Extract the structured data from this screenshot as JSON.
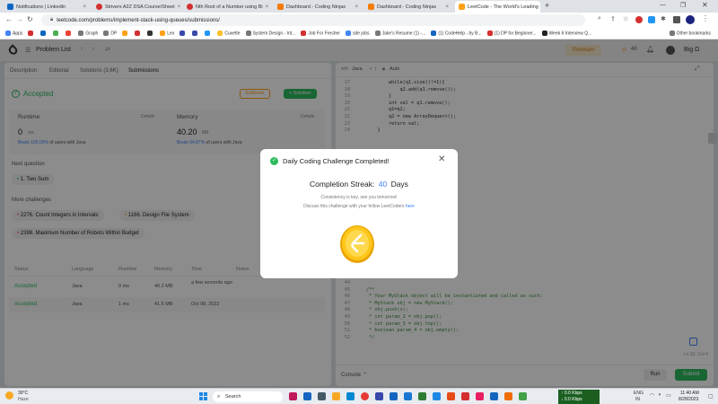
{
  "browser": {
    "tabs": [
      {
        "title": "Notifications | LinkedIn",
        "color": "#0a66c2"
      },
      {
        "title": "Strivers A2Z DSA Course/Sheet",
        "color": "#d32f2f"
      },
      {
        "title": "Nth Root of a Number using Bi",
        "color": "#d32f2f"
      },
      {
        "title": "Dashboard - Coding Ninjas",
        "color": "#f57c00"
      },
      {
        "title": "Dashboard - Coding Ninjas",
        "color": "#f57c00"
      },
      {
        "title": "LeetCode - The World's Leading",
        "color": "#ffa116"
      }
    ],
    "new_tab": "+",
    "url": "leetcode.com/problems/implement-stack-using-queues/submissions/",
    "bookmarks": [
      "Apps",
      "Graph",
      "DP",
      "Lex",
      "Cuvette",
      "System Design - Int...",
      "Job For Fresher",
      "sde jobs",
      "Jake's Resume (1) -...",
      "(1) CodeHelp - by B...",
      "(1) DP for Beginner...",
      "Week 6 Interview Q..."
    ],
    "other_bookmarks": "Other bookmarks"
  },
  "nav": {
    "problem_list": "Problem List",
    "premium": "Premium",
    "streak": "40",
    "user": "Big Ω"
  },
  "left": {
    "tabs": [
      "Description",
      "Editorial",
      "Solutions (3.6K)",
      "Submissions"
    ],
    "status": "Accepted",
    "editorial_btn": "Editorial",
    "solution_btn": "+ Solution",
    "runtime_label": "Runtime",
    "runtime_value": "0",
    "runtime_unit": "ms",
    "runtime_beats_pct": "100.00%",
    "runtime_beats_rest": "of users with Java",
    "memory_label": "Memory",
    "memory_value": "40.20",
    "memory_unit": "MB",
    "memory_beats_pct": "64.87%",
    "memory_beats_rest": "of users with Java",
    "details": "Details",
    "next_q_label": "Next question",
    "next_q": "1. Two Sum",
    "more_label": "More challenges",
    "challenges": [
      "2276. Count Integers in Intervals",
      "1166. Design File System",
      "2398. Maximum Number of Robots Within Budget"
    ],
    "table_headers": [
      "Status",
      "Language",
      "Runtime",
      "Memory",
      "Time",
      "Notes"
    ],
    "rows": [
      {
        "status": "Accepted",
        "lang": "Java",
        "runtime": "0 ms",
        "memory": "40.2 MB",
        "time": "a few seconds ago"
      },
      {
        "status": "Accepted",
        "lang": "Java",
        "runtime": "1 ms",
        "memory": "41.5 MB",
        "time": "Oct 08, 2022"
      }
    ]
  },
  "editor": {
    "language": "Java",
    "auto": "Auto",
    "lines": [
      {
        "n": "17",
        "code": "        while(q1.size()!=1){"
      },
      {
        "n": "18",
        "code": "            q2.add(q1.remove());"
      },
      {
        "n": "19",
        "code": "        }"
      },
      {
        "n": "20",
        "code": "        int val = q1.remove();"
      },
      {
        "n": "21",
        "code": "        q1=q2;"
      },
      {
        "n": "22",
        "code": "        q2 = new ArrayDeque<>();"
      },
      {
        "n": "23",
        "code": "        return val;"
      },
      {
        "n": "24",
        "code": "    }"
      }
    ],
    "lines_bottom": [
      {
        "n": "44",
        "code": ""
      },
      {
        "n": "45",
        "code": "/**"
      },
      {
        "n": "46",
        "code": " * Your MyStack object will be instantiated and called as such:"
      },
      {
        "n": "47",
        "code": " * MyStack obj = new MyStack();"
      },
      {
        "n": "48",
        "code": " * obj.push(x);"
      },
      {
        "n": "49",
        "code": " * int param_2 = obj.pop();"
      },
      {
        "n": "50",
        "code": " * int param_3 = obj.top();"
      },
      {
        "n": "51",
        "code": " * boolean param_4 = obj.empty();"
      },
      {
        "n": "52",
        "code": " */"
      }
    ],
    "cursor": "Ln 52, Col 4",
    "console": "Console",
    "run": "Run",
    "submit": "Submit"
  },
  "modal": {
    "title": "Daily Coding Challenge Completed!",
    "streak_label": "Completion Streak:",
    "streak_value": "40",
    "streak_unit": "Days",
    "line1": "Consistency is key, see you tomorrow!",
    "line2": "Discuss this challenge with your fellow LeetCoders",
    "here": "here",
    "coin_icon": "leetcode-coin-icon"
  },
  "taskbar": {
    "temp": "30°C",
    "weather": "Haze",
    "search": "Search",
    "net_up": "0.0 Kbps",
    "net_down": "0.0 Kbps",
    "lang1": "ENG",
    "lang2": "IN",
    "time": "11:40 AM",
    "date": "8/28/2023"
  },
  "colors": {
    "accepted": "#2cbb5d",
    "accent": "#ffa116",
    "blue_link": "#3b82f6"
  }
}
